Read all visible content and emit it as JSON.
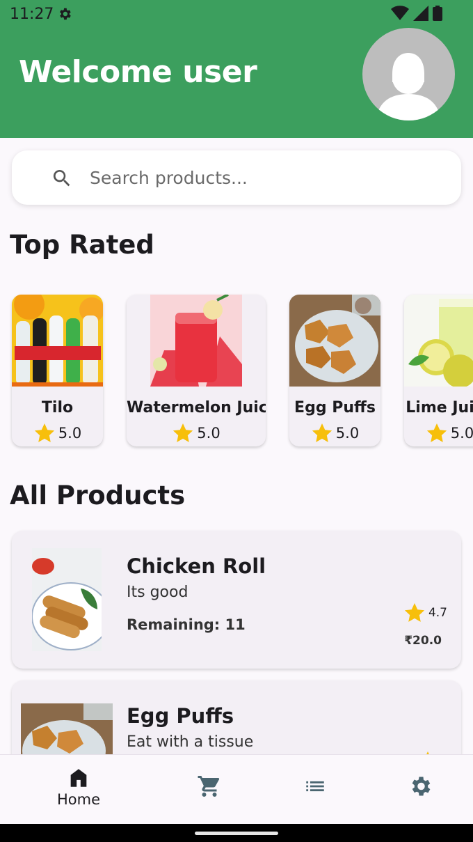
{
  "status_bar": {
    "time": "11:27"
  },
  "header": {
    "welcome_text": "Welcome user"
  },
  "search": {
    "placeholder": "Search products..."
  },
  "sections": {
    "top_rated": "Top Rated",
    "all_products": "All Products"
  },
  "top_rated": [
    {
      "name": "Tilo",
      "rating": "5.0"
    },
    {
      "name": "Watermelon Juice",
      "rating": "5.0"
    },
    {
      "name": "Egg Puffs",
      "rating": "5.0"
    },
    {
      "name": "Lime Juice",
      "rating": "5.0"
    }
  ],
  "products": [
    {
      "name": "Chicken Roll",
      "description": "Its good",
      "remaining": "Remaining: 11",
      "rating": "4.7",
      "price": "₹20.0"
    },
    {
      "name": "Egg Puffs",
      "description": "Eat with a tissue"
    }
  ],
  "bottom_nav": {
    "home_label": "Home"
  },
  "colors": {
    "primary_green": "#3c9f5e",
    "star": "#f7bf0b",
    "nav_icon": "#4a6570"
  }
}
